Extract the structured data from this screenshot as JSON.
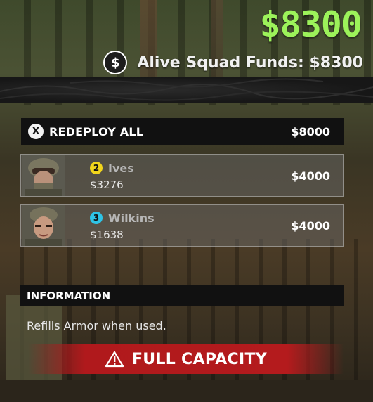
{
  "header": {
    "total_funds": "$8300",
    "squad_funds_label": "Alive Squad Funds: $8300",
    "funds_icon": "dollar-icon",
    "funds_color": "#9cf25a"
  },
  "redeploy": {
    "button_icon": "X",
    "label": "REDEPLOY ALL",
    "cost": "$8000"
  },
  "squad": [
    {
      "badge": "2",
      "badge_color": "#f1d51c",
      "name": "Ives",
      "money": "$3276",
      "cost": "$4000"
    },
    {
      "badge": "3",
      "badge_color": "#2ec4e6",
      "name": "Wilkins",
      "money": "$1638",
      "cost": "$4000"
    }
  ],
  "information": {
    "title": "INFORMATION",
    "description": "Refills Armor when used."
  },
  "status": {
    "label": "FULL CAPACITY",
    "icon": "warning-icon",
    "color": "#b41b1d"
  }
}
